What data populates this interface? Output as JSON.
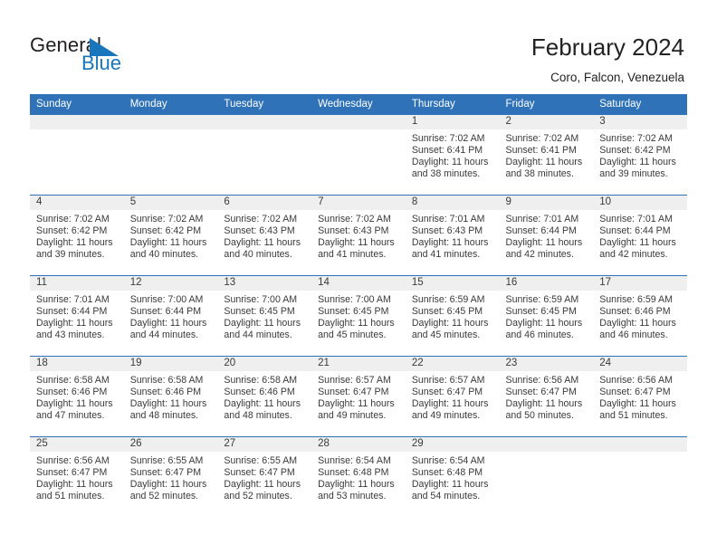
{
  "brand": {
    "name_part1": "General",
    "name_part2": "Blue",
    "triangle_color": "#1a76bc"
  },
  "header": {
    "title": "February 2024",
    "subtitle": "Coro, Falcon, Venezuela"
  },
  "theme": {
    "header_blue": "#2f72b8",
    "daynum_band": "#efefef",
    "text": "#3a3a3a"
  },
  "calendar": {
    "weekday_headers": [
      "Sunday",
      "Monday",
      "Tuesday",
      "Wednesday",
      "Thursday",
      "Friday",
      "Saturday"
    ],
    "weeks": [
      [
        {
          "day": "",
          "sunrise": "",
          "sunset": "",
          "daylight_line1": "",
          "daylight_line2": "",
          "empty": true
        },
        {
          "day": "",
          "sunrise": "",
          "sunset": "",
          "daylight_line1": "",
          "daylight_line2": "",
          "empty": true
        },
        {
          "day": "",
          "sunrise": "",
          "sunset": "",
          "daylight_line1": "",
          "daylight_line2": "",
          "empty": true
        },
        {
          "day": "",
          "sunrise": "",
          "sunset": "",
          "daylight_line1": "",
          "daylight_line2": "",
          "empty": true
        },
        {
          "day": "1",
          "sunrise": "Sunrise: 7:02 AM",
          "sunset": "Sunset: 6:41 PM",
          "daylight_line1": "Daylight: 11 hours",
          "daylight_line2": "and 38 minutes."
        },
        {
          "day": "2",
          "sunrise": "Sunrise: 7:02 AM",
          "sunset": "Sunset: 6:41 PM",
          "daylight_line1": "Daylight: 11 hours",
          "daylight_line2": "and 38 minutes."
        },
        {
          "day": "3",
          "sunrise": "Sunrise: 7:02 AM",
          "sunset": "Sunset: 6:42 PM",
          "daylight_line1": "Daylight: 11 hours",
          "daylight_line2": "and 39 minutes."
        }
      ],
      [
        {
          "day": "4",
          "sunrise": "Sunrise: 7:02 AM",
          "sunset": "Sunset: 6:42 PM",
          "daylight_line1": "Daylight: 11 hours",
          "daylight_line2": "and 39 minutes."
        },
        {
          "day": "5",
          "sunrise": "Sunrise: 7:02 AM",
          "sunset": "Sunset: 6:42 PM",
          "daylight_line1": "Daylight: 11 hours",
          "daylight_line2": "and 40 minutes."
        },
        {
          "day": "6",
          "sunrise": "Sunrise: 7:02 AM",
          "sunset": "Sunset: 6:43 PM",
          "daylight_line1": "Daylight: 11 hours",
          "daylight_line2": "and 40 minutes."
        },
        {
          "day": "7",
          "sunrise": "Sunrise: 7:02 AM",
          "sunset": "Sunset: 6:43 PM",
          "daylight_line1": "Daylight: 11 hours",
          "daylight_line2": "and 41 minutes."
        },
        {
          "day": "8",
          "sunrise": "Sunrise: 7:01 AM",
          "sunset": "Sunset: 6:43 PM",
          "daylight_line1": "Daylight: 11 hours",
          "daylight_line2": "and 41 minutes."
        },
        {
          "day": "9",
          "sunrise": "Sunrise: 7:01 AM",
          "sunset": "Sunset: 6:44 PM",
          "daylight_line1": "Daylight: 11 hours",
          "daylight_line2": "and 42 minutes."
        },
        {
          "day": "10",
          "sunrise": "Sunrise: 7:01 AM",
          "sunset": "Sunset: 6:44 PM",
          "daylight_line1": "Daylight: 11 hours",
          "daylight_line2": "and 42 minutes."
        }
      ],
      [
        {
          "day": "11",
          "sunrise": "Sunrise: 7:01 AM",
          "sunset": "Sunset: 6:44 PM",
          "daylight_line1": "Daylight: 11 hours",
          "daylight_line2": "and 43 minutes."
        },
        {
          "day": "12",
          "sunrise": "Sunrise: 7:00 AM",
          "sunset": "Sunset: 6:44 PM",
          "daylight_line1": "Daylight: 11 hours",
          "daylight_line2": "and 44 minutes."
        },
        {
          "day": "13",
          "sunrise": "Sunrise: 7:00 AM",
          "sunset": "Sunset: 6:45 PM",
          "daylight_line1": "Daylight: 11 hours",
          "daylight_line2": "and 44 minutes."
        },
        {
          "day": "14",
          "sunrise": "Sunrise: 7:00 AM",
          "sunset": "Sunset: 6:45 PM",
          "daylight_line1": "Daylight: 11 hours",
          "daylight_line2": "and 45 minutes."
        },
        {
          "day": "15",
          "sunrise": "Sunrise: 6:59 AM",
          "sunset": "Sunset: 6:45 PM",
          "daylight_line1": "Daylight: 11 hours",
          "daylight_line2": "and 45 minutes."
        },
        {
          "day": "16",
          "sunrise": "Sunrise: 6:59 AM",
          "sunset": "Sunset: 6:45 PM",
          "daylight_line1": "Daylight: 11 hours",
          "daylight_line2": "and 46 minutes."
        },
        {
          "day": "17",
          "sunrise": "Sunrise: 6:59 AM",
          "sunset": "Sunset: 6:46 PM",
          "daylight_line1": "Daylight: 11 hours",
          "daylight_line2": "and 46 minutes."
        }
      ],
      [
        {
          "day": "18",
          "sunrise": "Sunrise: 6:58 AM",
          "sunset": "Sunset: 6:46 PM",
          "daylight_line1": "Daylight: 11 hours",
          "daylight_line2": "and 47 minutes."
        },
        {
          "day": "19",
          "sunrise": "Sunrise: 6:58 AM",
          "sunset": "Sunset: 6:46 PM",
          "daylight_line1": "Daylight: 11 hours",
          "daylight_line2": "and 48 minutes."
        },
        {
          "day": "20",
          "sunrise": "Sunrise: 6:58 AM",
          "sunset": "Sunset: 6:46 PM",
          "daylight_line1": "Daylight: 11 hours",
          "daylight_line2": "and 48 minutes."
        },
        {
          "day": "21",
          "sunrise": "Sunrise: 6:57 AM",
          "sunset": "Sunset: 6:47 PM",
          "daylight_line1": "Daylight: 11 hours",
          "daylight_line2": "and 49 minutes."
        },
        {
          "day": "22",
          "sunrise": "Sunrise: 6:57 AM",
          "sunset": "Sunset: 6:47 PM",
          "daylight_line1": "Daylight: 11 hours",
          "daylight_line2": "and 49 minutes."
        },
        {
          "day": "23",
          "sunrise": "Sunrise: 6:56 AM",
          "sunset": "Sunset: 6:47 PM",
          "daylight_line1": "Daylight: 11 hours",
          "daylight_line2": "and 50 minutes."
        },
        {
          "day": "24",
          "sunrise": "Sunrise: 6:56 AM",
          "sunset": "Sunset: 6:47 PM",
          "daylight_line1": "Daylight: 11 hours",
          "daylight_line2": "and 51 minutes."
        }
      ],
      [
        {
          "day": "25",
          "sunrise": "Sunrise: 6:56 AM",
          "sunset": "Sunset: 6:47 PM",
          "daylight_line1": "Daylight: 11 hours",
          "daylight_line2": "and 51 minutes."
        },
        {
          "day": "26",
          "sunrise": "Sunrise: 6:55 AM",
          "sunset": "Sunset: 6:47 PM",
          "daylight_line1": "Daylight: 11 hours",
          "daylight_line2": "and 52 minutes."
        },
        {
          "day": "27",
          "sunrise": "Sunrise: 6:55 AM",
          "sunset": "Sunset: 6:47 PM",
          "daylight_line1": "Daylight: 11 hours",
          "daylight_line2": "and 52 minutes."
        },
        {
          "day": "28",
          "sunrise": "Sunrise: 6:54 AM",
          "sunset": "Sunset: 6:48 PM",
          "daylight_line1": "Daylight: 11 hours",
          "daylight_line2": "and 53 minutes."
        },
        {
          "day": "29",
          "sunrise": "Sunrise: 6:54 AM",
          "sunset": "Sunset: 6:48 PM",
          "daylight_line1": "Daylight: 11 hours",
          "daylight_line2": "and 54 minutes."
        },
        {
          "day": "",
          "sunrise": "",
          "sunset": "",
          "daylight_line1": "",
          "daylight_line2": "",
          "empty": true
        },
        {
          "day": "",
          "sunrise": "",
          "sunset": "",
          "daylight_line1": "",
          "daylight_line2": "",
          "empty": true
        }
      ]
    ]
  }
}
